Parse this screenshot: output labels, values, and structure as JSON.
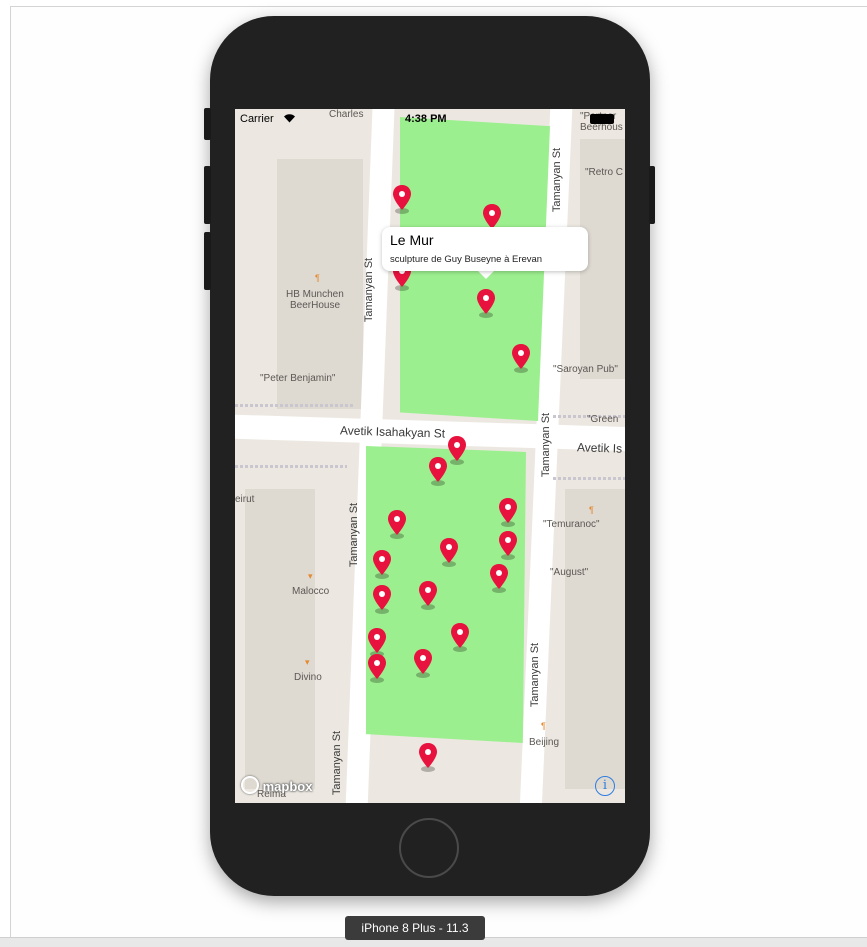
{
  "status_bar": {
    "carrier": "Carrier",
    "time": "4:38 PM"
  },
  "callout": {
    "title": "Le Mur",
    "subtitle": "sculpture de Guy Buseyne à Erevan"
  },
  "streets": {
    "tamanyan": "Tamanyan St",
    "avetik_left": "Avetik Isahakyan St",
    "avetik_right": "Avetik Is"
  },
  "places": {
    "charles": "Charles",
    "partner": "\"Partner",
    "beerhous": "Beerhous",
    "retro": "\"Retro C",
    "hb_munchen": "HB Munchen",
    "beerhouse": "BeerHouse",
    "peter": "\"Peter Benjamin\"",
    "saroyan": "\"Saroyan Pub\"",
    "green": "\"Green",
    "beirut": "eirut",
    "temuranoc": "\"Temuranoc\"",
    "august": "\"August\"",
    "malocco": "Malocco",
    "divino": "Divino",
    "beijing": "Beijing",
    "reima": "Reima"
  },
  "map": {
    "attribution": "mapbox"
  },
  "device": {
    "name": "iPhone 8 Plus - 11.3"
  },
  "icons": {
    "marker": "map-pin-icon",
    "info": "info-icon",
    "wifi": "wifi-icon",
    "battery": "battery-icon",
    "mapbox_logo": "mapbox-logo-icon",
    "home": "home-button"
  },
  "colors": {
    "pin": "#e8123e",
    "park": "#9cef8f",
    "accent": "#2f7de1"
  },
  "marker_count": 23
}
